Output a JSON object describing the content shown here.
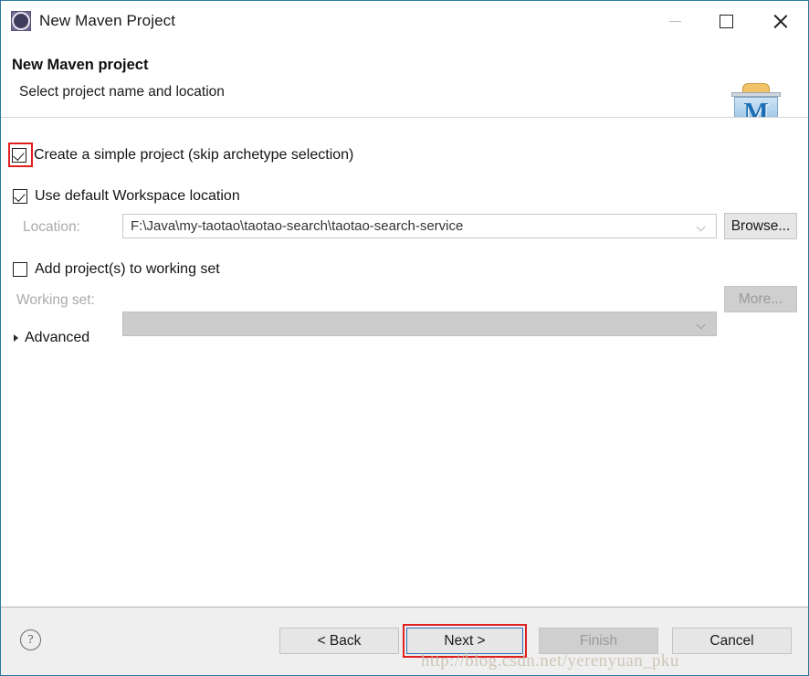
{
  "window": {
    "title": "New Maven Project",
    "icon": "maven-gear-icon",
    "controls": {
      "minimize": "minimize-icon",
      "maximize": "maximize-icon",
      "close": "close-icon"
    }
  },
  "header": {
    "title": "New Maven project",
    "subtitle": "Select project name and location",
    "banner_icon": "maven-folder-icon",
    "banner_icon_letter": "M"
  },
  "form": {
    "simple_project": {
      "label": "Create a simple project (skip archetype selection)",
      "checked": true,
      "highlighted": true
    },
    "default_workspace": {
      "label": "Use default Workspace location",
      "checked": true
    },
    "location": {
      "label": "Location:",
      "value": "F:\\Java\\my-taotao\\taotao-search\\taotao-search-service",
      "placeholder": "",
      "disabled": true,
      "browse_label": "Browse..."
    },
    "add_to_working_set": {
      "label": "Add project(s) to working set",
      "checked": false
    },
    "working_set": {
      "label": "Working set:",
      "value": "",
      "placeholder": "",
      "disabled": true,
      "more_label": "More..."
    },
    "advanced": {
      "label": "Advanced",
      "expanded": false
    }
  },
  "footer": {
    "help": "?",
    "buttons": {
      "back": "< Back",
      "next": "Next >",
      "finish": "Finish",
      "cancel": "Cancel"
    },
    "next_highlighted": true,
    "finish_disabled": true
  },
  "watermark": "http://blog.csdn.net/yerenyuan_pku",
  "colors": {
    "window_border": "#2b7a9b",
    "highlight_red": "#e02020",
    "focus_blue": "#2a6fb5",
    "footer_bg": "#efefef",
    "disabled_text": "#999999",
    "maven_blue": "#1f6fb5"
  }
}
